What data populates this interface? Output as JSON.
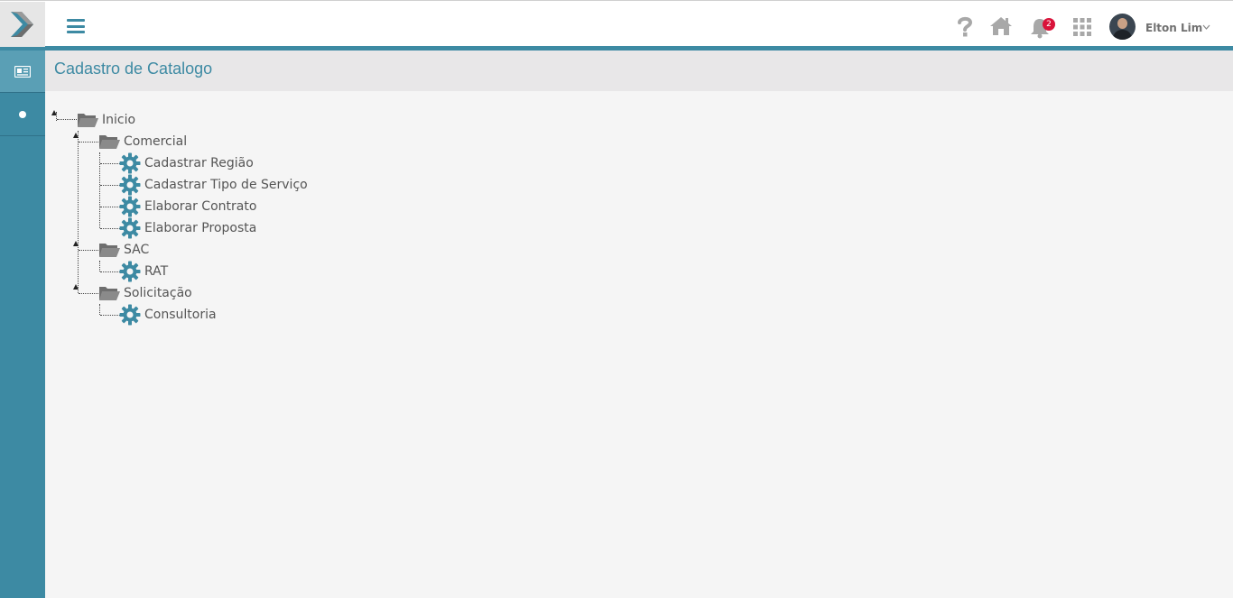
{
  "header": {
    "user_name": "Elton Lim",
    "notification_count": "2"
  },
  "page": {
    "title": "Cadastro de Catalogo"
  },
  "tree": {
    "root": "Inicio",
    "groups": [
      {
        "label": "Comercial",
        "items": [
          "Cadastrar Região",
          "Cadastrar Tipo de Serviço",
          "Elaborar Contrato",
          "Elaborar Proposta"
        ]
      },
      {
        "label": "SAC",
        "items": [
          "RAT"
        ]
      },
      {
        "label": "Solicitação",
        "items": [
          "Consultoria"
        ]
      }
    ]
  },
  "colors": {
    "accent": "#3d8aa3",
    "badge": "#d9133a",
    "folder": "#7b7b7b",
    "gear": "#3d8aa3"
  },
  "icons": {
    "logo": "brand-chevron-logo",
    "menu": "hamburger-icon",
    "help": "question-icon",
    "home": "home-icon",
    "notifications": "bell-icon",
    "apps": "grid-icon",
    "sidebar_first": "id-card-icon",
    "sidebar_second": "dot-icon",
    "folder": "folder-open-icon",
    "item": "gear-icon"
  }
}
